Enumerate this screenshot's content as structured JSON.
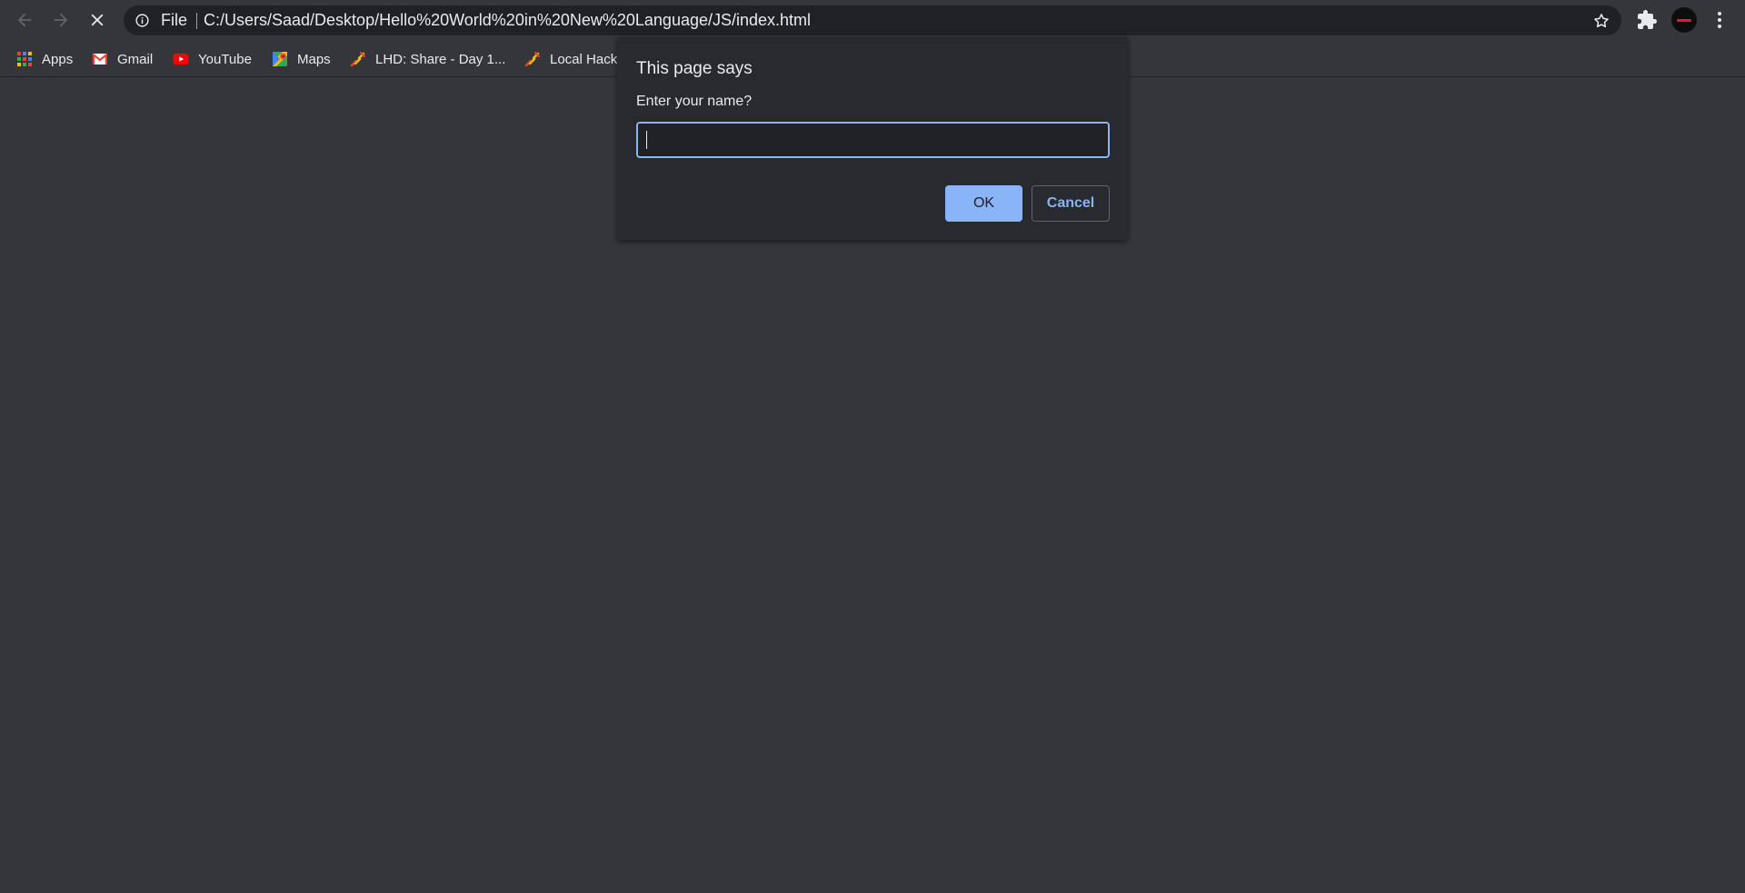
{
  "toolbar": {
    "back_icon": "back-arrow-icon",
    "forward_icon": "forward-arrow-icon",
    "stop_icon": "close-icon",
    "omnibox": {
      "scheme_label": "File",
      "url": "C:/Users/Saad/Desktop/Hello%20World%20in%20New%20Language/JS/index.html"
    }
  },
  "bookmarks": [
    {
      "label": "Apps",
      "icon": "apps-grid-icon"
    },
    {
      "label": "Gmail",
      "icon": "gmail-icon"
    },
    {
      "label": "YouTube",
      "icon": "youtube-icon"
    },
    {
      "label": "Maps",
      "icon": "maps-icon"
    },
    {
      "label": "LHD: Share - Day 1...",
      "icon": "mlh-icon"
    },
    {
      "label": "Local Hack",
      "icon": "mlh-icon"
    }
  ],
  "dialog": {
    "title": "This page says",
    "message": "Enter your name?",
    "input_value": "",
    "ok_label": "OK",
    "cancel_label": "Cancel"
  },
  "colors": {
    "chrome_bg": "#35363a",
    "omnibox_bg": "#202124",
    "dialog_bg": "#292a2d",
    "accent": "#8ab4f8",
    "text": "#e8eaed"
  }
}
